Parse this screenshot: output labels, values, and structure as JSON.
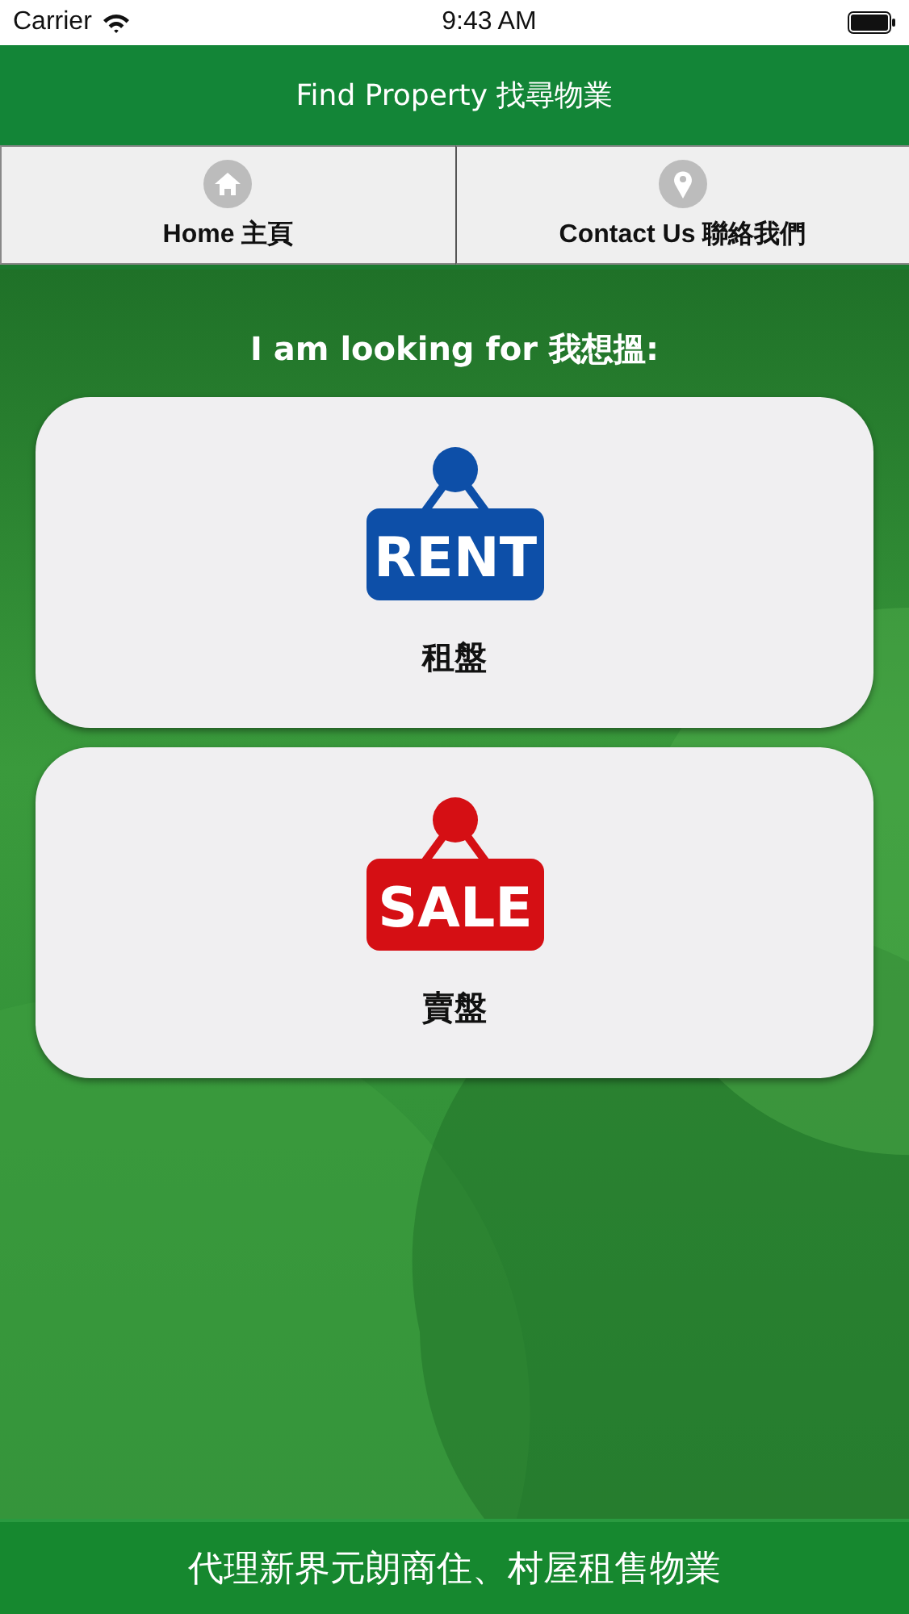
{
  "status_bar": {
    "carrier": "Carrier",
    "time": "9:43 AM"
  },
  "header": {
    "title": "Find Property 找尋物業"
  },
  "nav": [
    {
      "label": "Home 主頁",
      "kind": "home"
    },
    {
      "label": "Contact Us 聯絡我們",
      "kind": "contact"
    }
  ],
  "prompt": "I am looking for 我想搵:",
  "options": [
    {
      "sign_text": "RENT",
      "label": "租盤",
      "color": "#0d4fa8"
    },
    {
      "sign_text": "SALE",
      "label": "賣盤",
      "color": "#d50f14"
    }
  ],
  "footer": "代理新界元朗商住、村屋租售物業"
}
